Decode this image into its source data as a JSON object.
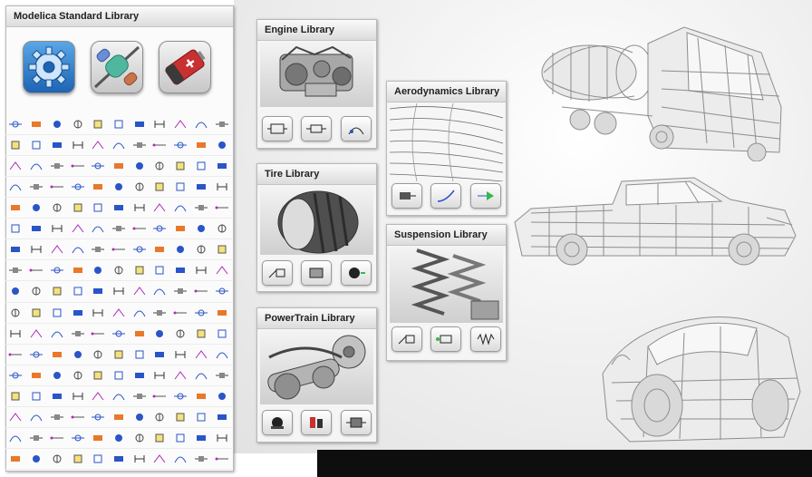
{
  "modelica": {
    "title": "Modelica Standard Library",
    "icons": [
      "gear-icon",
      "resistor-icon",
      "battery-icon"
    ]
  },
  "libraries": {
    "engine": "Engine Library",
    "tire": "Tire Library",
    "powertrain": "PowerTrain Library",
    "aerodynamics": "Aerodynamics Library",
    "suspension": "Suspension Library"
  },
  "colors": {
    "gear_blue": "#2f7fcf",
    "resistor_teal": "#4fb79f",
    "battery_red": "#c93030",
    "component_blue": "#2a55c8",
    "component_orange": "#e9782a",
    "component_green": "#33b84a",
    "component_magenta": "#b02bbd"
  },
  "vehicles": [
    "tanker-truck-wireframe",
    "pickup-truck-wireframe",
    "sports-car-wireframe"
  ]
}
